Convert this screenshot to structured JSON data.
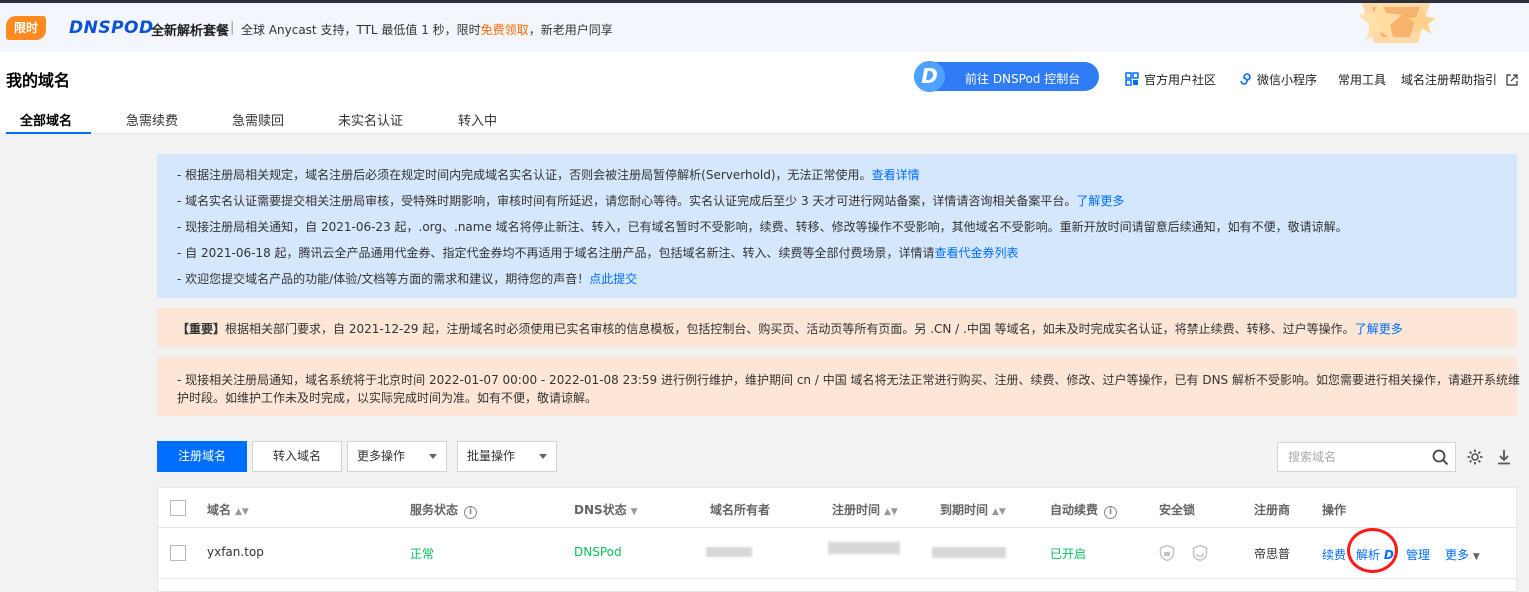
{
  "promo": {
    "tag": "限时",
    "brand": "DNSPOD",
    "package": "全新解析套餐",
    "separator": "|",
    "text_before": "全球 Anycast 支持，TTL 最低值 1 秒，限时",
    "text_highlight": "免费领取",
    "text_after": "，新老用户同享"
  },
  "header": {
    "title": "我的域名",
    "console_button_logo": "D",
    "console_button": "前往 DNSPod 控制台",
    "links": [
      "官方用户社区",
      "微信小程序",
      "常用工具",
      "域名注册帮助指引"
    ]
  },
  "tabs": [
    "全部域名",
    "急需续费",
    "急需赎回",
    "未实名认证",
    "转入中"
  ],
  "notices_blue": [
    {
      "text": "- 根据注册局相关规定，域名注册后必须在规定时间内完成域名实名认证，否则会被注册局暂停解析(Serverhold)，无法正常使用。",
      "link": "查看详情"
    },
    {
      "text": "- 域名实名认证需要提交相关注册局审核，受特殊时期影响，审核时间有所延迟，请您耐心等待。实名认证完成后至少 3 天才可进行网站备案，详情请咨询相关备案平台。",
      "link": "了解更多"
    },
    {
      "text": "- 现接注册局相关通知，自 2021-06-23 起，.org、.name 域名将停止新注、转入，已有域名暂时不受影响，续费、转移、修改等操作不受影响，其他域名不受影响。重新开放时间请留意后续通知，如有不便，敬请谅解。",
      "link": ""
    },
    {
      "text": "- 自 2021-06-18 起，腾讯云全产品通用代金券、指定代金券均不再适用于域名注册产品，包括域名新注、转入、续费等全部付费场景，详情请",
      "link": "查看代金券列表"
    },
    {
      "text": "- 欢迎您提交域名产品的功能/体验/文档等方面的需求和建议，期待您的声音！",
      "link": "点此提交"
    }
  ],
  "notice_important": {
    "prefix": "【重要】",
    "text": "根据相关部门要求，自 2021-12-29 起，注册域名时必须使用已实名审核的信息模板，包括控制台、购买页、活动页等所有页面。另 .CN / .中国 等域名，如未及时完成实名认证，将禁止续费、转移、过户等操作。",
    "link": "了解更多"
  },
  "notice_maintenance": {
    "line1": "- 现接相关注册局通知，域名系统将于北京时间 2022-01-07 00:00 - 2022-01-08 23:59 进行例行维护，维护期间 cn / 中国 域名将无法正常进行购买、注册、续费、修改、过户等操作，已有 DNS 解析不受影响。如您需要进行相关操作，请避开系统维",
    "line2": "护时段。如维护工作未及时完成，以实际完成时间为准。如有不便，敬请谅解。"
  },
  "toolbar": {
    "register": "注册域名",
    "transfer": "转入域名",
    "more_ops": "更多操作",
    "batch_ops": "批量操作",
    "search_placeholder": "搜索域名"
  },
  "table": {
    "headers": [
      "域名",
      "服务状态",
      "DNS状态",
      "域名所有者",
      "注册时间",
      "到期时间",
      "自动续费",
      "安全锁",
      "注册商",
      "操作"
    ],
    "rows": [
      {
        "domain": "yxfan.top",
        "service_status": "正常",
        "dns_status": "DNSPod",
        "auto_renew": "已开启",
        "registrar": "帝思普",
        "actions": {
          "renew": "续费",
          "resolve": "解析",
          "resolve_logo": "D",
          "manage": "管理",
          "more": "更多"
        }
      }
    ]
  },
  "colors": {
    "primary": "#006eff",
    "promo_tag": "#ff8a1f",
    "highlight": "#ff6a00",
    "success": "#0abf5b",
    "notice_blue": "#d5e7fd",
    "notice_orange": "#fde6d5",
    "annotation_circle": "#ff1a1a"
  }
}
